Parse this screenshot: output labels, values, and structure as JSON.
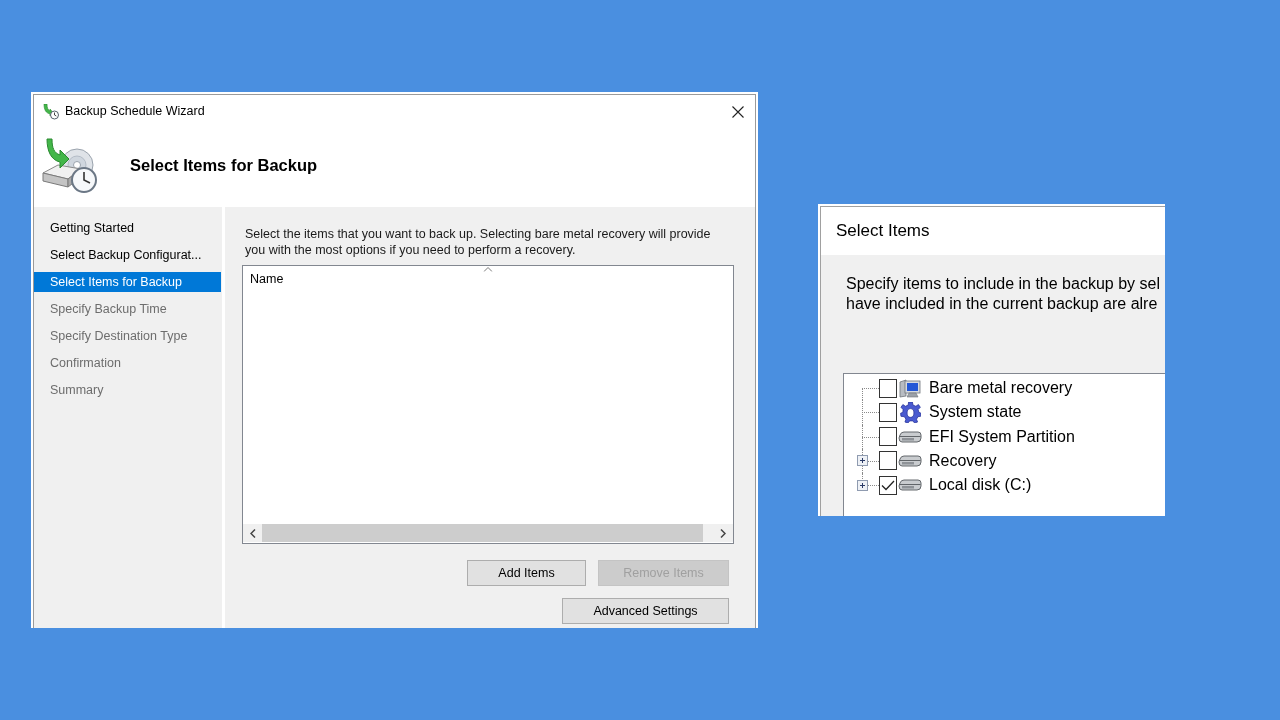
{
  "wizard": {
    "title": "Backup Schedule Wizard",
    "heading": "Select Items for Backup",
    "steps": [
      {
        "label": "Getting Started",
        "selected": false,
        "disabled": false
      },
      {
        "label": "Select Backup Configurat...",
        "selected": false,
        "disabled": false
      },
      {
        "label": "Select Items for Backup",
        "selected": true,
        "disabled": false
      },
      {
        "label": "Specify Backup Time",
        "selected": false,
        "disabled": true
      },
      {
        "label": "Specify Destination Type",
        "selected": false,
        "disabled": true
      },
      {
        "label": "Confirmation",
        "selected": false,
        "disabled": true
      },
      {
        "label": "Summary",
        "selected": false,
        "disabled": true
      }
    ],
    "description": "Select the items that you want to back up. Selecting bare metal recovery will provide you with the most options if you need to perform a recovery.",
    "items_list": {
      "columns": [
        {
          "label": "Name",
          "sorted": true
        }
      ]
    },
    "button_rows": [
      [
        {
          "label": "Add Items",
          "disabled": false
        },
        {
          "label": "Remove Items",
          "disabled": true
        }
      ],
      [
        {
          "label": "Advanced Settings",
          "disabled": false
        }
      ]
    ]
  },
  "select_items": {
    "title": "Select Items",
    "description_lines": [
      "Specify items to include in the backup by sel",
      "have included in the current backup are alre"
    ],
    "tree": [
      {
        "label": "Bare metal recovery",
        "kind": "machine",
        "checked": false
      },
      {
        "label": "System state",
        "kind": "state",
        "checked": false
      },
      {
        "label": "EFI System Partition",
        "kind": "volume",
        "checked": false
      },
      {
        "label": "Recovery",
        "kind": "volume",
        "checked": false,
        "expanded": false
      },
      {
        "label": "Local disk (C:)",
        "kind": "volume",
        "checked": true,
        "expanded": false
      }
    ]
  }
}
